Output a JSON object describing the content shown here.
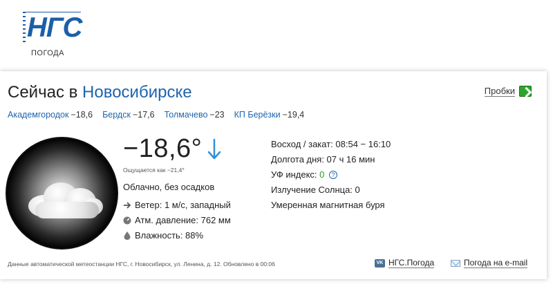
{
  "logo": {
    "mark": "НГС",
    "subtitle": "ПОГОДА"
  },
  "header": {
    "title_prefix": "Сейчас в",
    "city": "Новосибирске",
    "traffic_label": "Пробки"
  },
  "nearby": [
    {
      "name": "Академгородок",
      "temp": "−18,6"
    },
    {
      "name": "Бердск",
      "temp": "−17,6"
    },
    {
      "name": "Толмачево",
      "temp": "−23"
    },
    {
      "name": "КП Берёзки",
      "temp": "−19,4"
    }
  ],
  "current": {
    "temperature": "−18,6°",
    "trend_icon": "arrow-down-icon",
    "feels_like": "Ощущается как −21,4°",
    "condition": "Облачно, без осадков",
    "wind": "Ветер: 1 м/с, западный",
    "pressure": "Атм. давление: 762 мм",
    "humidity": "Влажность: 88%"
  },
  "details": {
    "sun": "Восход / закат: 08:54 − 16:10",
    "day_length": "Долгота дня: 07 ч 16 мин",
    "uv_label": "УФ индекс:",
    "uv_value": "0",
    "uv_help": "?",
    "radiation": "Излучение Солнца: 0",
    "magnetic": "Умеренная магнитная буря"
  },
  "footer": {
    "source": "Данные автоматической метеостанции НГС, г. Новосибирск, ул. Ленина, д. 12. Обновлено в 00:06",
    "vk_badge": "VK",
    "vk_link": "НГС.Погода",
    "email_link": "Погода на e-mail"
  },
  "colors": {
    "brand": "#1b5fa8",
    "link": "#1d64ad",
    "uv_ok": "#2a9a2a",
    "trend_arrow": "#2e8fd8"
  }
}
